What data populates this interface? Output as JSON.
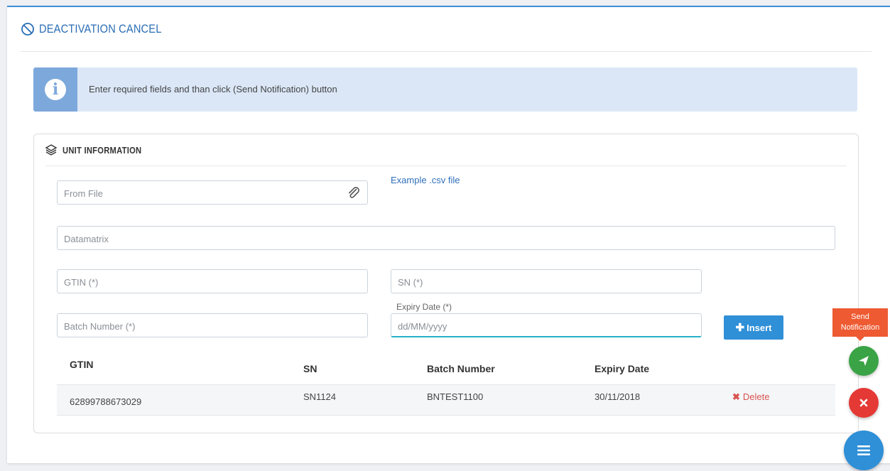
{
  "page": {
    "title": "DEACTIVATION CANCEL",
    "title_icon": "ban-icon"
  },
  "alert": {
    "icon": "info-icon",
    "icon_glyph": "i",
    "text": "Enter required fields and than click (Send Notification) button"
  },
  "unit_panel": {
    "title": "UNIT INFORMATION",
    "icon": "layers-icon"
  },
  "form": {
    "from_file_placeholder": "From File",
    "example_link": "Example .csv file",
    "datamatrix_placeholder": "Datamatrix",
    "gtin_placeholder": "GTIN (*)",
    "sn_placeholder": "SN (*)",
    "batch_placeholder": "Batch Number (*)",
    "expiry_label": "Expiry Date (*)",
    "expiry_placeholder": "dd/MM/yyyy",
    "insert_button": "Insert",
    "insert_icon": "plus-icon"
  },
  "table": {
    "columns": [
      "GTIN",
      "SN",
      "Batch Number",
      "Expiry Date"
    ],
    "rows": [
      {
        "gtin": "62899788673029",
        "sn": "SN1124",
        "batch": "BNTEST1100",
        "expiry": "30/11/2018",
        "action": "Delete"
      }
    ]
  },
  "fab": {
    "send_tooltip_line1": "Send",
    "send_tooltip_line2": "Notification",
    "send_icon": "paper-plane-icon",
    "cancel_icon": "close-icon",
    "menu_icon": "menu-icon"
  },
  "colors": {
    "accent": "#2f8fd7",
    "title": "#2a6db5",
    "alert_bg": "#dbe7f7",
    "alert_icon_bg": "#7da8dc",
    "send_green": "#3aa345",
    "cancel_red": "#e53935",
    "tooltip_orange": "#ee5a31",
    "delete_red": "#d9534f",
    "input_focus": "#26b0c9"
  }
}
